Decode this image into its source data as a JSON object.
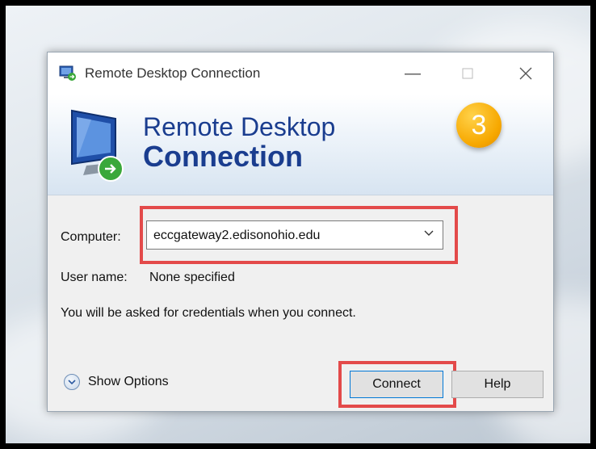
{
  "window": {
    "title": "Remote Desktop Connection",
    "controls": {
      "minimize": "minimize-icon",
      "maximize": "maximize-icon",
      "close": "close-icon"
    }
  },
  "banner": {
    "line1": "Remote Desktop",
    "line2": "Connection",
    "step_badge": "3"
  },
  "form": {
    "computer_label": "Computer:",
    "computer_value": "eccgateway2.edisonohio.edu",
    "username_label": "User name:",
    "username_value": "None specified",
    "credentials_note": "You will be asked for credentials when you connect."
  },
  "footer": {
    "show_options_label": "Show Options",
    "connect_label": "Connect",
    "help_label": "Help"
  },
  "colors": {
    "highlight": "#e34a4a",
    "banner_text": "#1a3d8f",
    "badge": "#f7a800"
  }
}
